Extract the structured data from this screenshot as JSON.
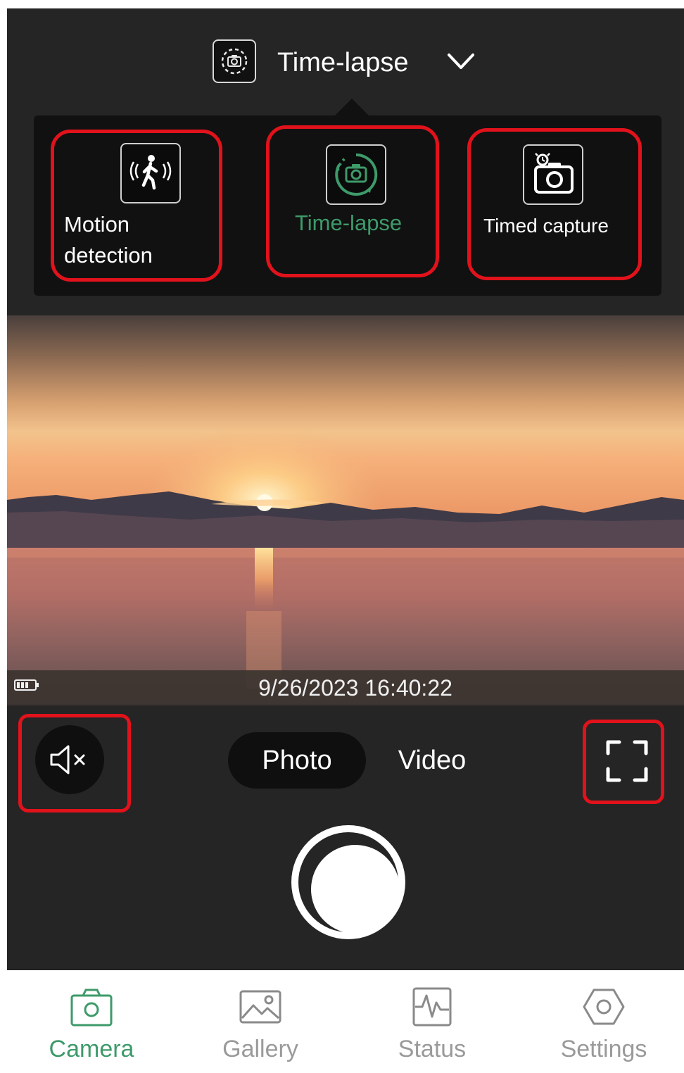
{
  "header": {
    "mode_title": "Time-lapse",
    "mode_icon": "timelapse-camera-icon",
    "dropdown_icon": "chevron-down-icon"
  },
  "capture_modes": [
    {
      "label": "Motion\ndetection",
      "icon": "walking-person-motion-icon",
      "selected": false
    },
    {
      "label": "Time-lapse",
      "icon": "timelapse-camera-icon",
      "selected": true
    },
    {
      "label": "Timed capture",
      "icon": "alarm-camera-icon",
      "selected": false
    }
  ],
  "preview": {
    "timestamp": "9/26/2023 16:40:22",
    "battery_icon": "battery-icon"
  },
  "controls": {
    "mute_icon": "speaker-muted-icon",
    "photo_label": "Photo",
    "video_label": "Video",
    "fullscreen_icon": "fullscreen-icon",
    "shutter": "shutter-button",
    "active_tab": "Photo"
  },
  "bottom_nav": [
    {
      "label": "Camera",
      "icon": "camera-icon",
      "active": true
    },
    {
      "label": "Gallery",
      "icon": "image-icon",
      "active": false
    },
    {
      "label": "Status",
      "icon": "waveform-icon",
      "active": false
    },
    {
      "label": "Settings",
      "icon": "hexagon-gear-icon",
      "active": false
    }
  ],
  "colors": {
    "accent": "#3e9a6a",
    "highlight": "#e1121b",
    "background": "#252525"
  }
}
